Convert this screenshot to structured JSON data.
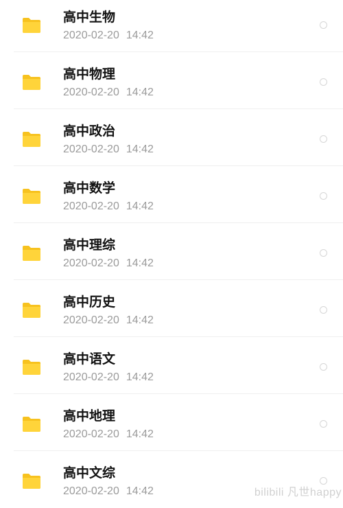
{
  "folders": [
    {
      "name": "高中生物",
      "date": "2020-02-20",
      "time": "14:42"
    },
    {
      "name": "高中物理",
      "date": "2020-02-20",
      "time": "14:42"
    },
    {
      "name": "高中政治",
      "date": "2020-02-20",
      "time": "14:42"
    },
    {
      "name": "高中数学",
      "date": "2020-02-20",
      "time": "14:42"
    },
    {
      "name": "高中理综",
      "date": "2020-02-20",
      "time": "14:42"
    },
    {
      "name": "高中历史",
      "date": "2020-02-20",
      "time": "14:42"
    },
    {
      "name": "高中语文",
      "date": "2020-02-20",
      "time": "14:42"
    },
    {
      "name": "高中地理",
      "date": "2020-02-20",
      "time": "14:42"
    },
    {
      "name": "高中文综",
      "date": "2020-02-20",
      "time": "14:42"
    }
  ],
  "watermark": "bilibili 凡世happy",
  "colors": {
    "folder": "#FFD43A",
    "folder_tab": "#F7C21F",
    "title": "#111111",
    "meta": "#9A9A9A",
    "radio_border": "#D6D6D6",
    "divider": "#EFEFEF"
  },
  "icons": {
    "folder": "folder-icon",
    "select": "radio-unchecked-icon"
  }
}
